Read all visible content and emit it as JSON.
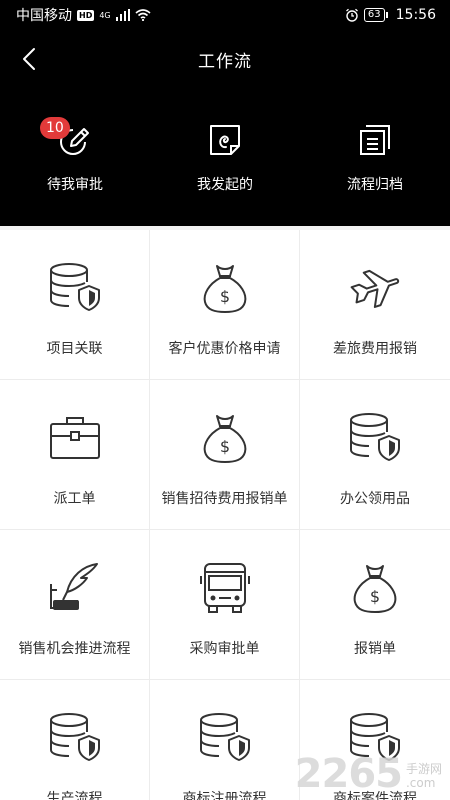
{
  "status_bar": {
    "carrier": "中国移动",
    "hd": "HD",
    "network": "4G",
    "battery": "63",
    "time": "15:56"
  },
  "header": {
    "title": "工作流",
    "back_icon": "chevron-left-icon"
  },
  "quick_actions": [
    {
      "label": "待我审批",
      "icon": "pen-circle-icon",
      "badge": "10"
    },
    {
      "label": "我发起的",
      "icon": "document-swirl-icon"
    },
    {
      "label": "流程归档",
      "icon": "archive-stack-icon"
    }
  ],
  "grid_items": [
    {
      "label": "项目关联",
      "icon": "database-shield-icon"
    },
    {
      "label": "客户优惠价格申请",
      "icon": "money-bag-icon"
    },
    {
      "label": "差旅费用报销",
      "icon": "airplane-icon"
    },
    {
      "label": "派工单",
      "icon": "briefcase-icon"
    },
    {
      "label": "销售招待费用报销单",
      "icon": "money-bag-icon"
    },
    {
      "label": "办公领用品",
      "icon": "database-shield-icon"
    },
    {
      "label": "销售机会推进流程",
      "icon": "quill-inkpot-icon"
    },
    {
      "label": "采购审批单",
      "icon": "bus-icon"
    },
    {
      "label": "报销单",
      "icon": "money-bag-icon"
    },
    {
      "label": "生产流程",
      "icon": "database-shield-icon"
    },
    {
      "label": "商标注册流程",
      "icon": "database-shield-icon"
    },
    {
      "label": "商标案件流程",
      "icon": "database-shield-icon"
    }
  ],
  "watermark": {
    "number": "2265",
    "line1": "手游网",
    "line2": ".com"
  },
  "colors": {
    "header_bg": "#000000",
    "badge": "#e23a3a",
    "icon_stroke": "#333333"
  }
}
